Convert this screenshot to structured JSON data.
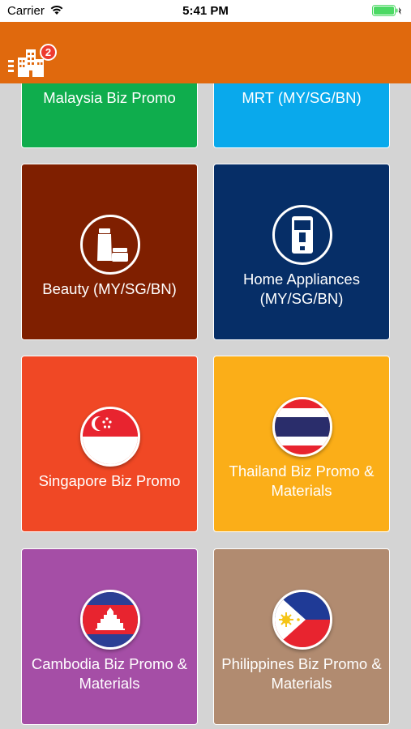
{
  "status_bar": {
    "carrier": "Carrier",
    "time": "5:41 PM"
  },
  "app_bar": {
    "notification_count": "2"
  },
  "tiles": [
    {
      "label": "Malaysia Biz Promo",
      "icon": "none",
      "color": "#0fad4d"
    },
    {
      "label": "MRT (MY/SG/BN)",
      "icon": "none",
      "color": "#09a9ec"
    },
    {
      "label": "Beauty (MY/SG/BN)",
      "icon": "cosmetics-icon",
      "color": "#7f1f00"
    },
    {
      "label": "Home Appliances (MY/SG/BN)",
      "icon": "appliance-icon",
      "color": "#062e67"
    },
    {
      "label": "Singapore Biz Promo",
      "icon": "singapore-flag-icon",
      "color": "#f04825"
    },
    {
      "label": "Thailand Biz Promo & Materials",
      "icon": "thailand-flag-icon",
      "color": "#fbae18"
    },
    {
      "label": "Cambodia Biz Promo & Materials",
      "icon": "cambodia-flag-icon",
      "color": "#a54ea6"
    },
    {
      "label": "Philippines Biz Promo & Materials",
      "icon": "philippines-flag-icon",
      "color": "#b18b70"
    }
  ]
}
